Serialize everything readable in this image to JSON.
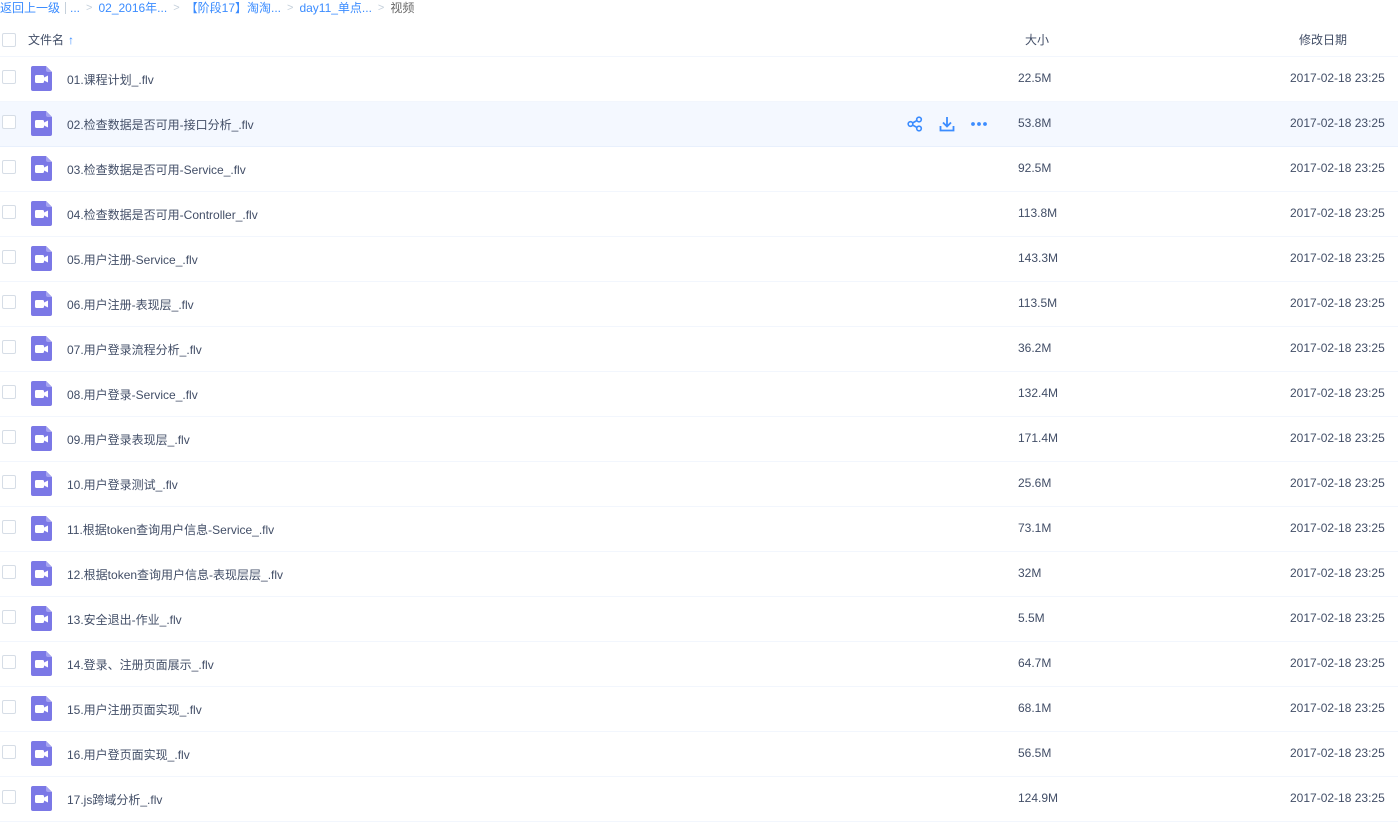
{
  "breadcrumb": {
    "back": "返回上一级",
    "items": [
      "...",
      "02_2016年...",
      "【阶段17】淘淘...",
      "day11_单点..."
    ],
    "current": "视频"
  },
  "header": {
    "name": "文件名",
    "size": "大小",
    "date": "修改日期"
  },
  "files": [
    {
      "name": "01.课程计划_.flv",
      "size": "22.5M",
      "date": "2017-02-18 23:25"
    },
    {
      "name": "02.检查数据是否可用-接口分析_.flv",
      "size": "53.8M",
      "date": "2017-02-18 23:25"
    },
    {
      "name": "03.检查数据是否可用-Service_.flv",
      "size": "92.5M",
      "date": "2017-02-18 23:25"
    },
    {
      "name": "04.检查数据是否可用-Controller_.flv",
      "size": "113.8M",
      "date": "2017-02-18 23:25"
    },
    {
      "name": "05.用户注册-Service_.flv",
      "size": "143.3M",
      "date": "2017-02-18 23:25"
    },
    {
      "name": "06.用户注册-表现层_.flv",
      "size": "113.5M",
      "date": "2017-02-18 23:25"
    },
    {
      "name": "07.用户登录流程分析_.flv",
      "size": "36.2M",
      "date": "2017-02-18 23:25"
    },
    {
      "name": "08.用户登录-Service_.flv",
      "size": "132.4M",
      "date": "2017-02-18 23:25"
    },
    {
      "name": "09.用户登录表现层_.flv",
      "size": "171.4M",
      "date": "2017-02-18 23:25"
    },
    {
      "name": "10.用户登录测试_.flv",
      "size": "25.6M",
      "date": "2017-02-18 23:25"
    },
    {
      "name": "11.根据token查询用户信息-Service_.flv",
      "size": "73.1M",
      "date": "2017-02-18 23:25"
    },
    {
      "name": "12.根据token查询用户信息-表现层层_.flv",
      "size": "32M",
      "date": "2017-02-18 23:25"
    },
    {
      "name": "13.安全退出-作业_.flv",
      "size": "5.5M",
      "date": "2017-02-18 23:25"
    },
    {
      "name": "14.登录、注册页面展示_.flv",
      "size": "64.7M",
      "date": "2017-02-18 23:25"
    },
    {
      "name": "15.用户注册页面实现_.flv",
      "size": "68.1M",
      "date": "2017-02-18 23:25"
    },
    {
      "name": "16.用户登页面实现_.flv",
      "size": "56.5M",
      "date": "2017-02-18 23:25"
    },
    {
      "name": "17.js跨域分析_.flv",
      "size": "124.9M",
      "date": "2017-02-18 23:25"
    }
  ],
  "hover_row": 1,
  "hover_actions": [
    "share-icon",
    "download-icon",
    "more-icon"
  ],
  "colors": {
    "accent": "#3b8cff",
    "video_icon": "#7b78e6",
    "row_hover": "#f4f8ff"
  }
}
